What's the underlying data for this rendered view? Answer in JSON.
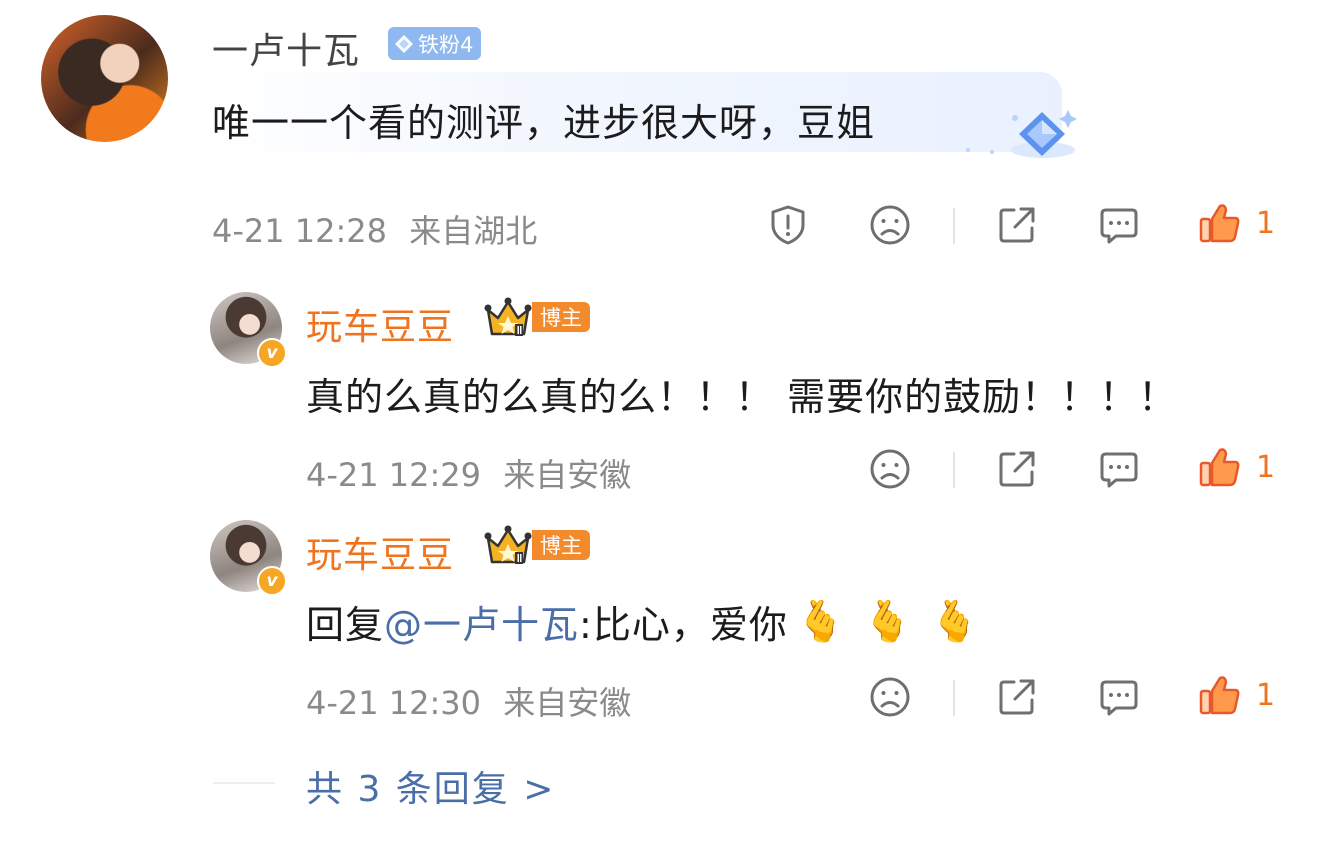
{
  "comment": {
    "username": "一卢十瓦",
    "fan_badge": "铁粉4",
    "text": "唯一一个看的测评，进步很大呀，豆姐",
    "time": "4-21 12:28",
    "location": "来自湖北",
    "likes": "1"
  },
  "replies": [
    {
      "username": "玩车豆豆",
      "role_badge": "博主",
      "verified_mark": "v",
      "text": "真的么真的么真的么！！！ 需要你的鼓励！！！！",
      "time": "4-21 12:29",
      "location": "来自安徽",
      "likes": "1"
    },
    {
      "username": "玩车豆豆",
      "role_badge": "博主",
      "verified_mark": "v",
      "reply_prefix": "回复",
      "mention": "@一卢十瓦",
      "text_after": ":比心，爱你",
      "emojis": [
        "🫰",
        "🫰",
        "🫰"
      ],
      "time": "4-21 12:30",
      "location": "来自安徽",
      "likes": "1"
    }
  ],
  "more_replies": "共 3 条回复 >",
  "icons": {
    "report": "report-icon",
    "dislike": "dislike-icon",
    "share": "share-icon",
    "reply": "reply-icon",
    "like": "like-icon"
  },
  "colors": {
    "accent_orange": "#f0731f",
    "mention_blue": "#4a6ea8",
    "fan_badge_blue": "#8fb8f0",
    "meta_grey": "#8a8a8a"
  }
}
